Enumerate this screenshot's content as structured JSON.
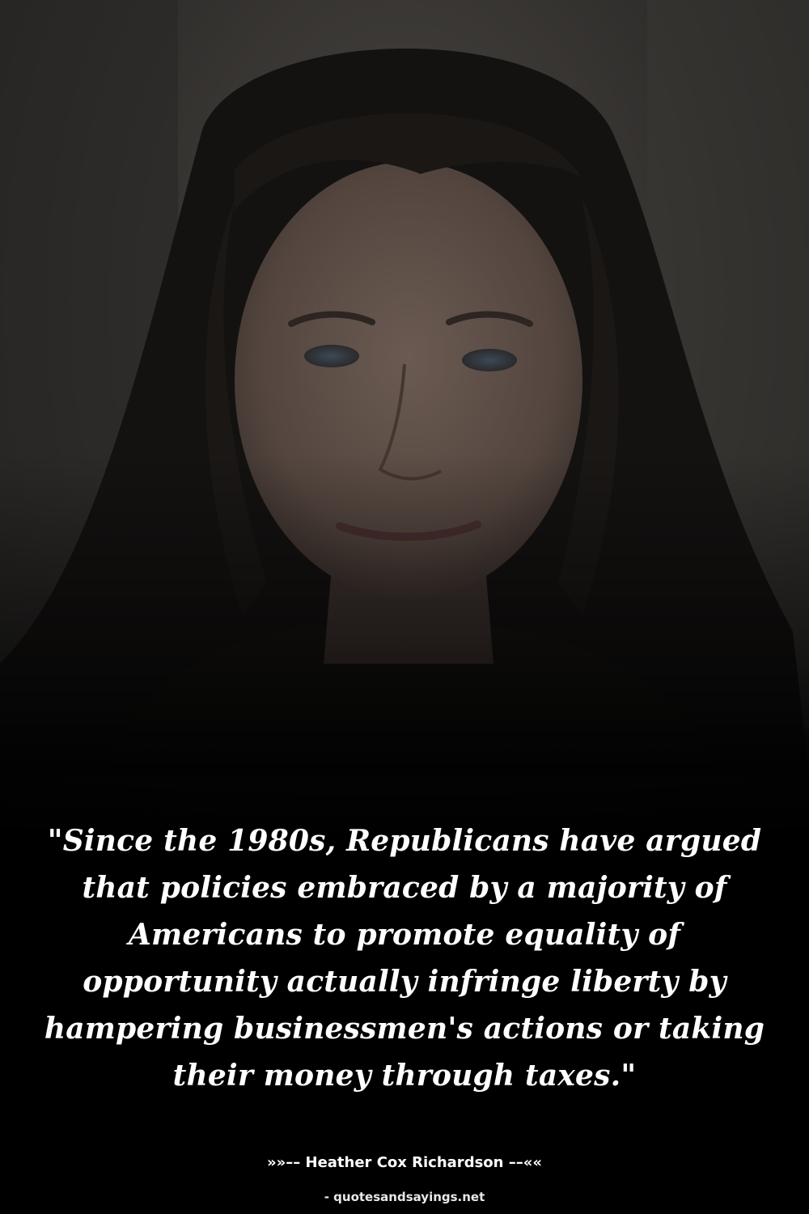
{
  "quote": {
    "text": "\"Since the 1980s, Republicans have argued that policies embraced by a majority of Americans to promote equality of opportunity actually infringe liberty by hampering businessmen's actions or taking their money through taxes.\""
  },
  "attribution": {
    "author_line": "»»–– Heather Cox Richardson ––««"
  },
  "footer": {
    "source": "- quotesandsayings.net"
  },
  "colors": {
    "background": "#000000",
    "text": "#ffffff"
  }
}
